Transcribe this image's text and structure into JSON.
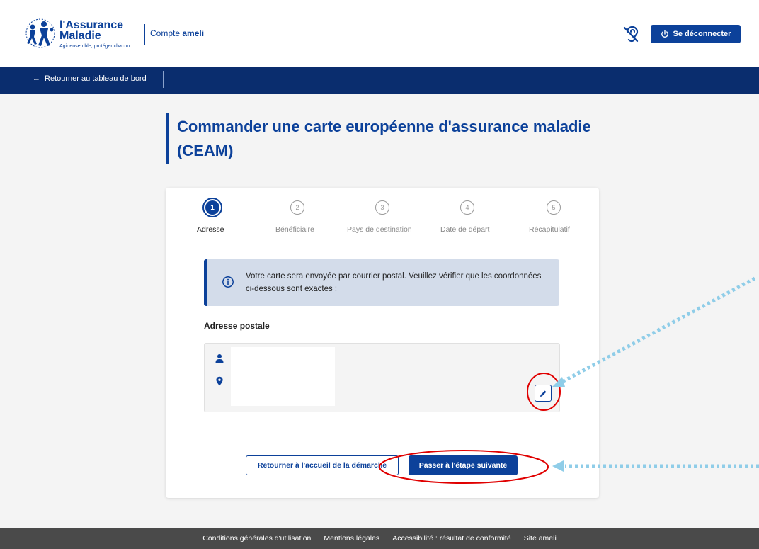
{
  "header": {
    "logo_title_line1": "l'Assurance",
    "logo_title_line2": "Maladie",
    "logo_tagline": "Agir ensemble, protéger chacun",
    "account_prefix": "Compte",
    "account_name": "ameli",
    "logout_label": "Se déconnecter",
    "accessibility_icon": "hearing-impaired-icon"
  },
  "navbar": {
    "back_label": "Retourner au tableau de bord"
  },
  "page": {
    "title": "Commander une carte européenne d'assurance maladie (CEAM)"
  },
  "stepper": {
    "steps": [
      {
        "number": "1",
        "label": "Adresse",
        "active": true
      },
      {
        "number": "2",
        "label": "Bénéficiaire",
        "active": false
      },
      {
        "number": "3",
        "label": "Pays de destination",
        "active": false
      },
      {
        "number": "4",
        "label": "Date de départ",
        "active": false
      },
      {
        "number": "5",
        "label": "Récapitulatif",
        "active": false
      }
    ]
  },
  "info": {
    "text": "Votre carte sera envoyée par courrier postal. Veuillez vérifier que les coordonnées ci-dessous sont exactes :"
  },
  "address": {
    "section_label": "Adresse postale",
    "person_icon": "person-icon",
    "location_icon": "map-pin-icon",
    "edit_icon": "pencil-icon"
  },
  "actions": {
    "back_label": "Retourner à l'accueil de la démarche",
    "next_label": "Passer à l'étape suivante"
  },
  "footer": {
    "links": [
      "Conditions générales d'utilisation",
      "Mentions légales",
      "Accessibilité : résultat de conformité",
      "Site ameli"
    ]
  },
  "colors": {
    "brand": "#0c419a",
    "navbar": "#0a2d6e",
    "info_bg": "#d3dcea",
    "footer": "#4a4a4a",
    "annotation_circle": "#e00000",
    "annotation_arrow": "#8fcde8"
  }
}
